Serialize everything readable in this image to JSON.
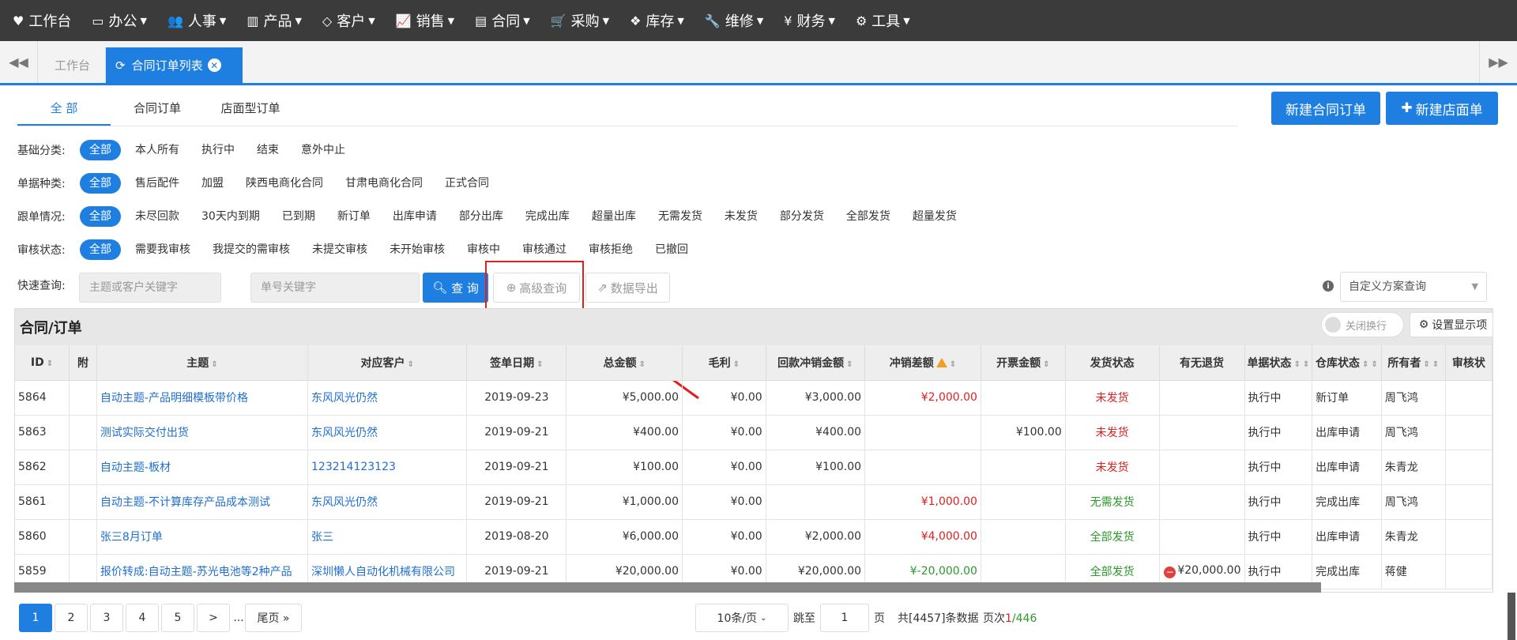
{
  "topnav": [
    {
      "icon": "heart-icon",
      "glyph": "♥",
      "label": "工作台",
      "caret": false
    },
    {
      "icon": "laptop-icon",
      "glyph": "▭",
      "label": "办公",
      "caret": true
    },
    {
      "icon": "users-icon",
      "glyph": "👥",
      "label": "人事",
      "caret": true
    },
    {
      "icon": "barcode-icon",
      "glyph": "▥",
      "label": "产品",
      "caret": true
    },
    {
      "icon": "diamond-icon",
      "glyph": "◇",
      "label": "客户",
      "caret": true
    },
    {
      "icon": "line-chart-icon",
      "glyph": "📈",
      "label": "销售",
      "caret": true
    },
    {
      "icon": "card-icon",
      "glyph": "▤",
      "label": "合同",
      "caret": true
    },
    {
      "icon": "cart-icon",
      "glyph": "🛒",
      "label": "采购",
      "caret": true
    },
    {
      "icon": "cubes-icon",
      "glyph": "❖",
      "label": "库存",
      "caret": true
    },
    {
      "icon": "wrench-icon",
      "glyph": "🔧",
      "label": "维修",
      "caret": true
    },
    {
      "icon": "yen-icon",
      "glyph": "¥",
      "label": "财务",
      "caret": true
    },
    {
      "icon": "gear-icon",
      "glyph": "⚙",
      "label": "工具",
      "caret": true
    }
  ],
  "tabs": {
    "home": "工作台",
    "active": "合同订单列表"
  },
  "subtabs": [
    "全 部",
    "合同订单",
    "店面型订单"
  ],
  "buttons": {
    "new_contract": "新建合同订单",
    "new_store": "新建店面单",
    "query": "查 询",
    "advanced": "高级查询",
    "export": "数据导出"
  },
  "filters": [
    {
      "label": "基础分类:",
      "chips": [
        "全部",
        "本人所有",
        "执行中",
        "结束",
        "意外中止"
      ]
    },
    {
      "label": "单据种类:",
      "chips": [
        "全部",
        "售后配件",
        "加盟",
        "陕西电商化合同",
        "甘肃电商化合同",
        "正式合同"
      ]
    },
    {
      "label": "跟单情况:",
      "chips": [
        "全部",
        "未尽回款",
        "30天内到期",
        "已到期",
        "新订单",
        "出库申请",
        "部分出库",
        "完成出库",
        "超量出库",
        "无需发货",
        "未发货",
        "部分发货",
        "全部发货",
        "超量发货"
      ]
    },
    {
      "label": "审核状态:",
      "chips": [
        "全部",
        "需要我审核",
        "我提交的需审核",
        "未提交审核",
        "未开始审核",
        "审核中",
        "审核通过",
        "审核拒绝",
        "已撤回"
      ]
    }
  ],
  "quicksearch": {
    "label": "快速查询:",
    "subject_placeholder": "主题或客户关键字",
    "number_placeholder": "单号关键字",
    "scheme": "自定义方案查询"
  },
  "panel": {
    "title": "合同/订单",
    "toggle": "关闭换行",
    "settings": "设置显示项"
  },
  "columns": [
    "ID",
    "附",
    "主题",
    "对应客户",
    "签单日期",
    "总金额",
    "毛利",
    "回款冲销金额",
    "冲销差额",
    "开票金额",
    "发货状态",
    "有无退货",
    "单据状态",
    "仓库状态",
    "所有者",
    "审核状"
  ],
  "rows": [
    {
      "id": "5864",
      "subject": "自动主题-产品明细模板带价格",
      "customer": "东风风光仍然",
      "date": "2019-09-23",
      "total": "¥5,000.00",
      "profit": "¥0.00",
      "paid": "¥3,000.00",
      "diff": "¥2,000.00",
      "diff_color": "red",
      "invoice": "",
      "ship": "未发货",
      "ship_color": "red",
      "ret": "",
      "status": "执行中",
      "wh": "新订单",
      "owner": "周飞鸿"
    },
    {
      "id": "5863",
      "subject": "测试实际交付出货",
      "customer": "东风风光仍然",
      "date": "2019-09-21",
      "total": "¥400.00",
      "profit": "¥0.00",
      "paid": "¥400.00",
      "diff": "",
      "diff_color": "",
      "invoice": "¥100.00",
      "ship": "未发货",
      "ship_color": "red",
      "ret": "",
      "status": "执行中",
      "wh": "出库申请",
      "owner": "周飞鸿"
    },
    {
      "id": "5862",
      "subject": "自动主题-板材",
      "customer": "123214123123",
      "date": "2019-09-21",
      "total": "¥100.00",
      "profit": "¥0.00",
      "paid": "¥100.00",
      "diff": "",
      "diff_color": "",
      "invoice": "",
      "ship": "未发货",
      "ship_color": "red",
      "ret": "",
      "status": "执行中",
      "wh": "出库申请",
      "owner": "朱青龙"
    },
    {
      "id": "5861",
      "subject": "自动主题-不计算库存产品成本测试",
      "customer": "东风风光仍然",
      "date": "2019-09-21",
      "total": "¥1,000.00",
      "profit": "¥0.00",
      "paid": "",
      "diff": "¥1,000.00",
      "diff_color": "red",
      "invoice": "",
      "ship": "无需发货",
      "ship_color": "green",
      "ret": "",
      "status": "执行中",
      "wh": "完成出库",
      "owner": "周飞鸿"
    },
    {
      "id": "5860",
      "subject": "张三8月订单",
      "customer": "张三",
      "date": "2019-08-20",
      "total": "¥6,000.00",
      "profit": "¥0.00",
      "paid": "¥2,000.00",
      "diff": "¥4,000.00",
      "diff_color": "red",
      "invoice": "",
      "ship": "全部发货",
      "ship_color": "green",
      "ret": "",
      "status": "执行中",
      "wh": "出库申请",
      "owner": "朱青龙"
    },
    {
      "id": "5859",
      "subject": "报价转成:自动主题-苏光电池等2种产品",
      "customer": "深圳懒人自动化机械有限公司",
      "date": "2019-09-21",
      "total": "¥20,000.00",
      "profit": "¥0.00",
      "paid": "¥20,000.00",
      "diff": "¥-20,000.00",
      "diff_color": "green",
      "invoice": "",
      "ship": "全部发货",
      "ship_color": "green",
      "ret": "¥20,000.00",
      "status": "执行中",
      "wh": "完成出库",
      "owner": "蒋健"
    }
  ],
  "pagination": {
    "pages": [
      "1",
      "2",
      "3",
      "4",
      "5",
      ">"
    ],
    "dots": "...",
    "last": "尾页 »",
    "per_page": "10条/页",
    "jump_label": "跳至",
    "jump_value": "1",
    "page_unit": "页",
    "total": "共[4457]条数据",
    "page_of_label": "页次",
    "current": "1",
    "total_pages": "/446"
  },
  "colors": {
    "accent": "#1e7fe0",
    "nav_bg": "#3b3b3b",
    "red": "#e02020",
    "green": "#2a9a2a"
  }
}
